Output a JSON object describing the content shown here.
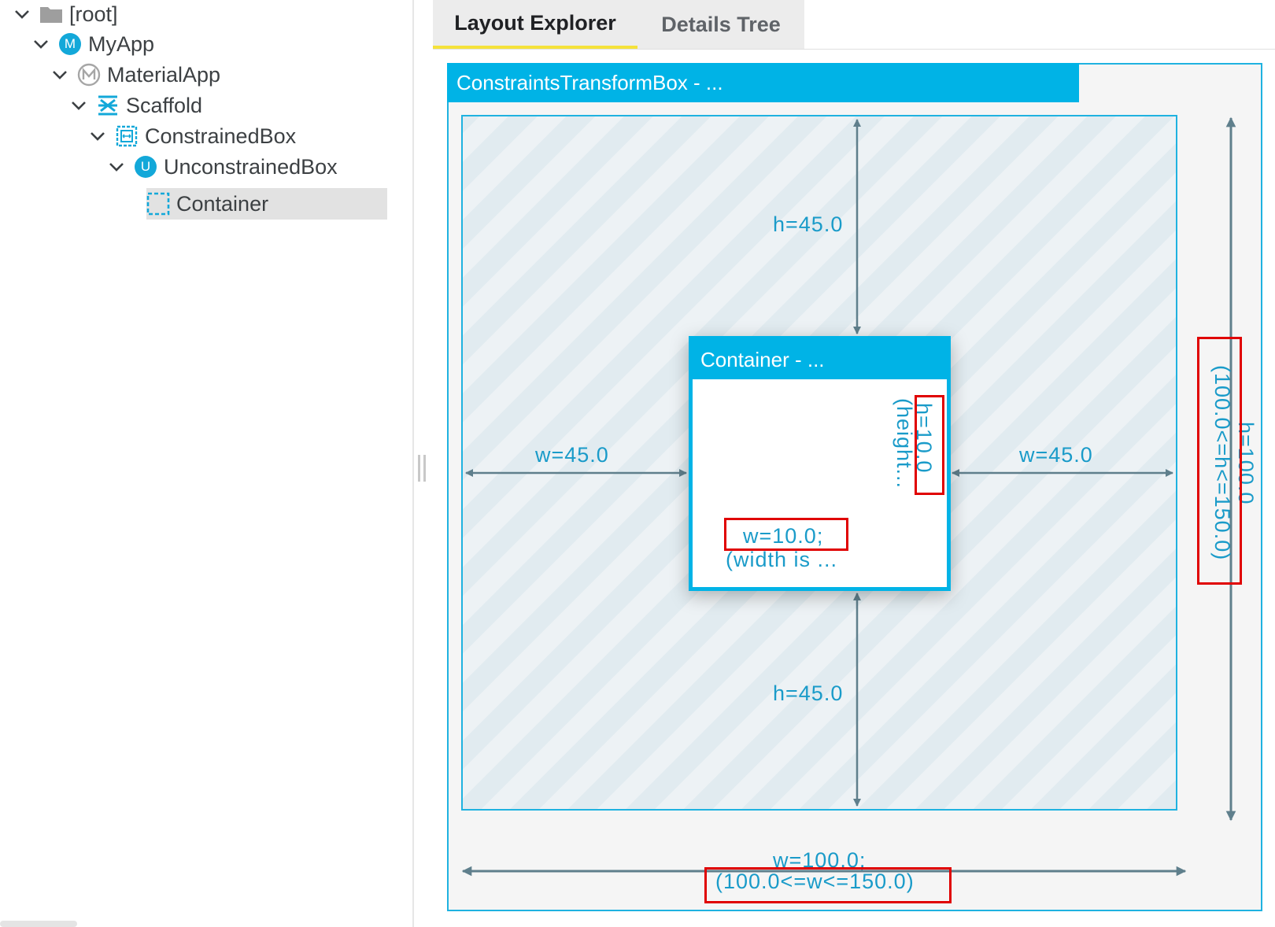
{
  "tree": {
    "items": [
      {
        "label": "[root]",
        "icon": "folder-icon"
      },
      {
        "label": "MyApp",
        "icon": "badge-m-icon",
        "badge": "M"
      },
      {
        "label": "MaterialApp",
        "icon": "material-app-icon"
      },
      {
        "label": "Scaffold",
        "icon": "scaffold-icon"
      },
      {
        "label": "ConstrainedBox",
        "icon": "constrained-box-icon"
      },
      {
        "label": "UnconstrainedBox",
        "icon": "badge-u-icon",
        "badge": "U"
      },
      {
        "label": "Container",
        "icon": "container-icon",
        "selected": true
      }
    ]
  },
  "tabs": {
    "layout": "Layout Explorer",
    "details": "Details Tree"
  },
  "explorer": {
    "outer_header": "ConstraintsTransformBox - ...",
    "container_header": "Container - ...",
    "top_gap": "h=45.0",
    "bottom_gap": "h=45.0",
    "left_gap": "w=45.0",
    "right_gap": "w=45.0",
    "inner_width": "w=10.0;",
    "inner_width_note": "(width is ...",
    "inner_height": "h=10.0",
    "inner_height_note": "(height...",
    "outer_width": "w=100.0;",
    "outer_width_constraint": "(100.0<=w<=150.0)",
    "outer_height": "h=100.0",
    "outer_height_constraint": "(100.0<=h<=150.0)"
  },
  "colors": {
    "accent": "#00b3e6",
    "tab_indicator": "#f5e23a",
    "highlight_red": "#e00000",
    "arrow": "#5f7f8c"
  }
}
